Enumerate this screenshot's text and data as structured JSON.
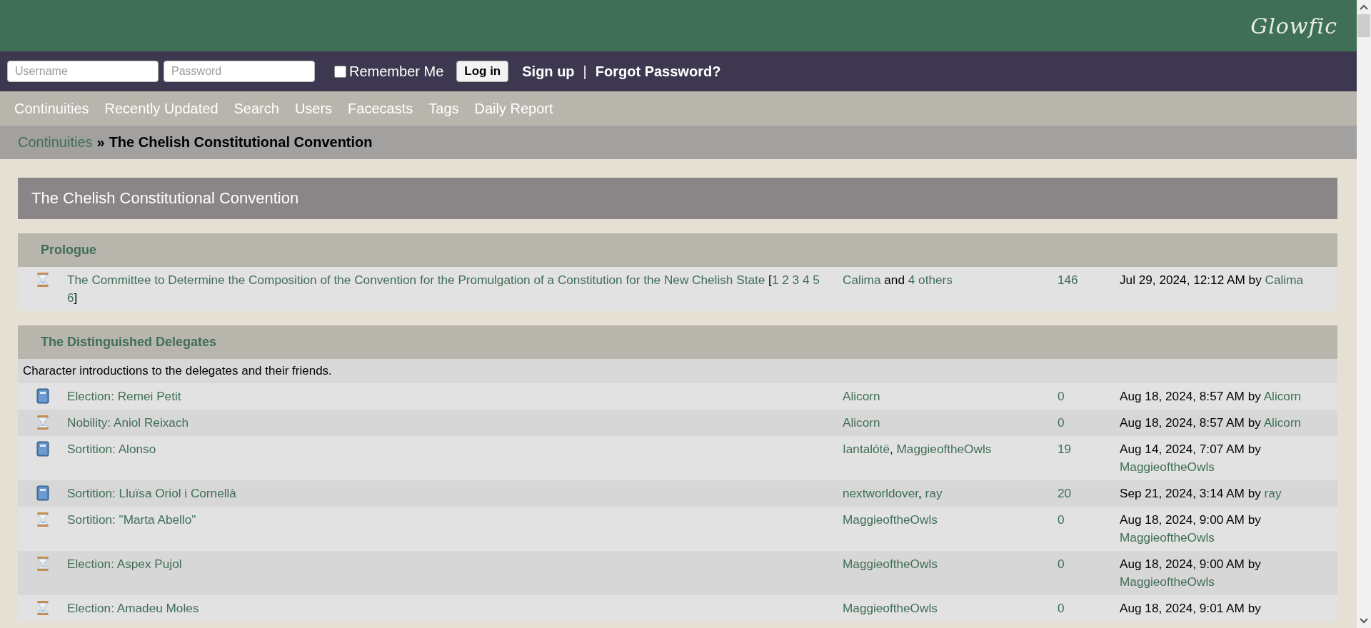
{
  "header": {
    "logo": "Glowfic"
  },
  "login": {
    "username": {
      "placeholder": "Username"
    },
    "password": {
      "placeholder": "Password"
    },
    "remember": {
      "label": "Remember Me",
      "checked": false
    },
    "login_button": "Log in",
    "signup": "Sign up",
    "divider": "|",
    "forgot": "Forgot Password?"
  },
  "nav": [
    "Continuities",
    "Recently Updated",
    "Search",
    "Users",
    "Facecasts",
    "Tags",
    "Daily Report"
  ],
  "breadcrumb": {
    "link": "Continuities",
    "separator": "»",
    "current": "The Chelish Constitutional Convention"
  },
  "continuity_title": "The Chelish Constitutional Convention",
  "sections": [
    {
      "title": "Prologue",
      "posts": [
        {
          "kind": "hourglass",
          "title": "The Committee to Determine the Composition of the Convention for the Promulgation of a Constitution for the New Chelish State",
          "pages": {
            "open": "[",
            "numbers": [
              "1",
              "2",
              "3",
              "4",
              "5",
              "6"
            ],
            "close": "]"
          },
          "authors": [
            {
              "kind": "link",
              "text": "Calima"
            },
            {
              "kind": "text",
              "text": "and"
            },
            {
              "kind": "link",
              "text": "4 others"
            }
          ],
          "replies": "146",
          "updated": "Jul 29, 2024, 12:12 AM by",
          "updated_by": "Calima"
        }
      ]
    },
    {
      "title": "The Distinguished Delegates",
      "description": "Character introductions to the delegates and their friends.",
      "posts": [
        {
          "kind": "book",
          "title": "Election: Remei Petit",
          "authors": [
            {
              "kind": "link",
              "text": "Alicorn"
            }
          ],
          "replies": "0",
          "updated": "Aug 18, 2024, 8:57 AM by",
          "updated_by": "Alicorn"
        },
        {
          "kind": "hourglass",
          "title": "Nobility: Aniol Reixach",
          "authors": [
            {
              "kind": "link",
              "text": "Alicorn"
            }
          ],
          "replies": "0",
          "updated": "Aug 18, 2024, 8:57 AM by",
          "updated_by": "Alicorn"
        },
        {
          "kind": "book",
          "title": "Sortition: Alonso",
          "authors": [
            {
              "kind": "link",
              "text": "Iantalótë"
            },
            {
              "kind": "comma",
              "text": ","
            },
            {
              "kind": "link",
              "text": "MaggieoftheOwls"
            }
          ],
          "replies": "19",
          "updated": "Aug 14, 2024, 7:07 AM by",
          "updated_by": "MaggieoftheOwls"
        },
        {
          "kind": "book",
          "title": "Sortition: Lluïsa Oriol i Cornellà",
          "authors": [
            {
              "kind": "link",
              "text": "nextworldover"
            },
            {
              "kind": "comma",
              "text": ","
            },
            {
              "kind": "link",
              "text": "ray"
            }
          ],
          "replies": "20",
          "updated": "Sep 21, 2024, 3:14 AM by",
          "updated_by": "ray"
        },
        {
          "kind": "hourglass",
          "title": "Sortition: \"Marta Abello\"",
          "authors": [
            {
              "kind": "link",
              "text": "MaggieoftheOwls"
            }
          ],
          "replies": "0",
          "updated": "Aug 18, 2024, 9:00 AM by",
          "updated_by": "MaggieoftheOwls"
        },
        {
          "kind": "hourglass",
          "title": "Election: Aspex Pujol",
          "authors": [
            {
              "kind": "link",
              "text": "MaggieoftheOwls"
            }
          ],
          "replies": "0",
          "updated": "Aug 18, 2024, 9:00 AM by",
          "updated_by": "MaggieoftheOwls"
        },
        {
          "kind": "hourglass",
          "title": "Election: Amadeu Moles",
          "authors": [
            {
              "kind": "link",
              "text": "MaggieoftheOwls"
            }
          ],
          "replies": "0",
          "updated": "Aug 18, 2024, 9:01 AM by"
        }
      ]
    }
  ]
}
